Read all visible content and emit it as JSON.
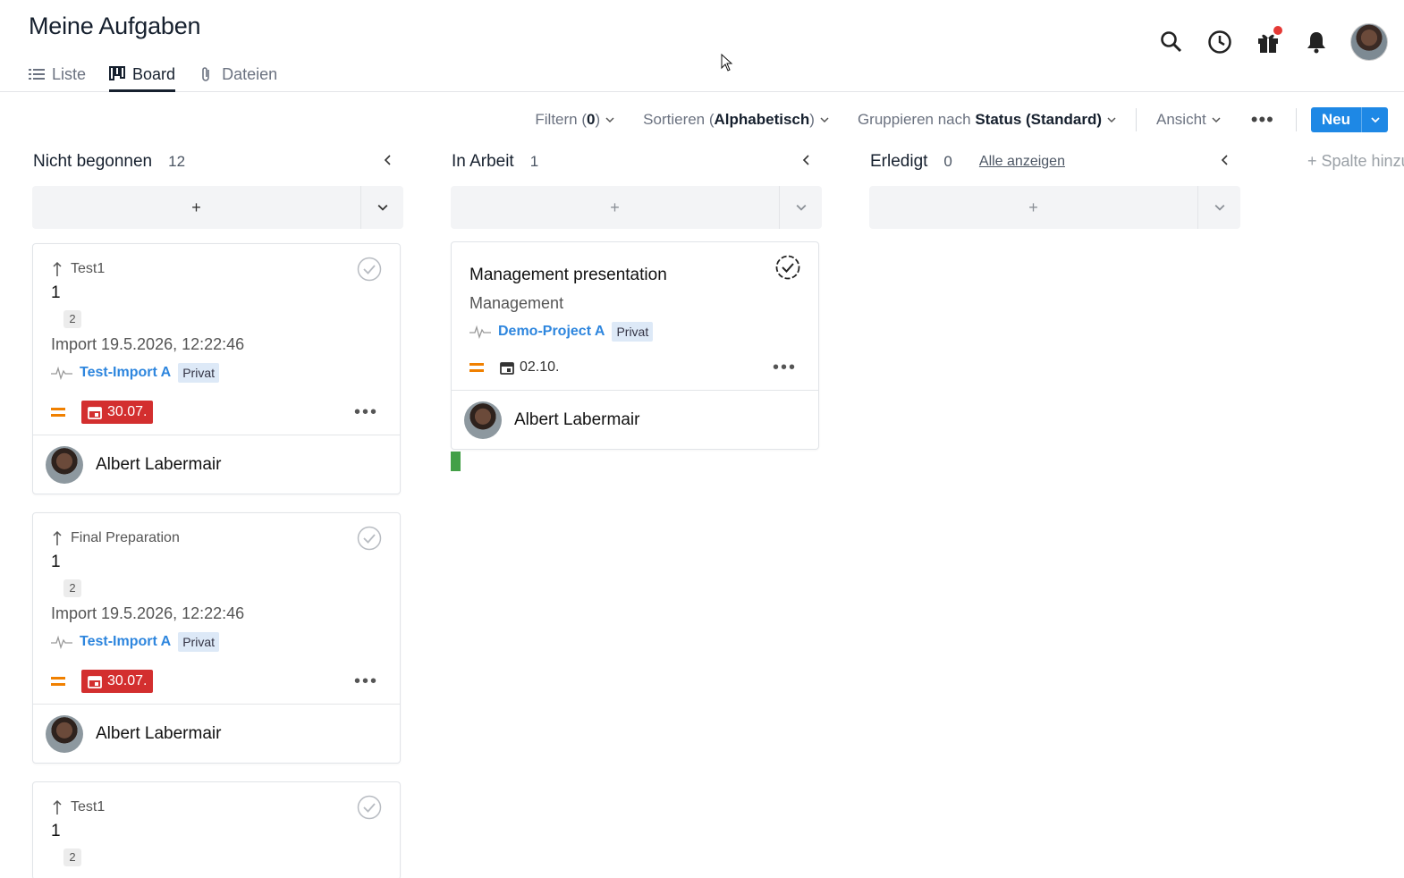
{
  "header": {
    "title": "Meine Aufgaben",
    "tabs": [
      {
        "label": "Liste",
        "icon": "list-icon"
      },
      {
        "label": "Board",
        "icon": "board-icon"
      },
      {
        "label": "Dateien",
        "icon": "paperclip-icon"
      }
    ],
    "active_tab": "Board",
    "icons": [
      "search-icon",
      "history-icon",
      "gift-icon",
      "bell-icon",
      "avatar"
    ]
  },
  "toolbar": {
    "filter_prefix": "Filtern (",
    "filter_count": "0",
    "filter_suffix": ")",
    "sort_prefix": "Sortieren (",
    "sort_value": "Alphabetisch",
    "sort_suffix": ")",
    "group_prefix": "Gruppieren nach",
    "group_value": "Status (Standard)",
    "view_label": "Ansicht",
    "more_label": "•••",
    "new_label": "Neu"
  },
  "columns": [
    {
      "title": "Nicht begonnen",
      "count": "12",
      "add_label": "+",
      "cards": [
        {
          "parent": "Test1",
          "title": "1",
          "subtasks": "2",
          "description": "Import 19.5.2026, 12:22:46",
          "project": "Test-Import A",
          "visibility": "Privat",
          "due": "30.07.",
          "assignee": "Albert Labermair"
        },
        {
          "parent": "Final Preparation",
          "title": "1",
          "subtasks": "2",
          "description": "Import 19.5.2026, 12:22:46",
          "project": "Test-Import A",
          "visibility": "Privat",
          "due": "30.07.",
          "assignee": "Albert Labermair"
        },
        {
          "parent": "Test1",
          "title": "1",
          "subtasks": "2"
        }
      ]
    },
    {
      "title": "In Arbeit",
      "count": "1",
      "add_label": "+",
      "cards": [
        {
          "title": "Management presentation",
          "description": "Management",
          "project": "Demo-Project A",
          "visibility": "Privat",
          "due": "02.10.",
          "assignee": "Albert Labermair"
        }
      ]
    },
    {
      "title": "Erledigt",
      "count": "0",
      "link": "Alle anzeigen",
      "add_label": "+"
    }
  ],
  "add_column_label": "+ Spalte hinzufügen",
  "colors": {
    "accent": "#1e88e5",
    "due_overdue": "#d32f2f",
    "priority": "#f08000",
    "project_link": "#2e86de",
    "progress": "#43a047"
  }
}
